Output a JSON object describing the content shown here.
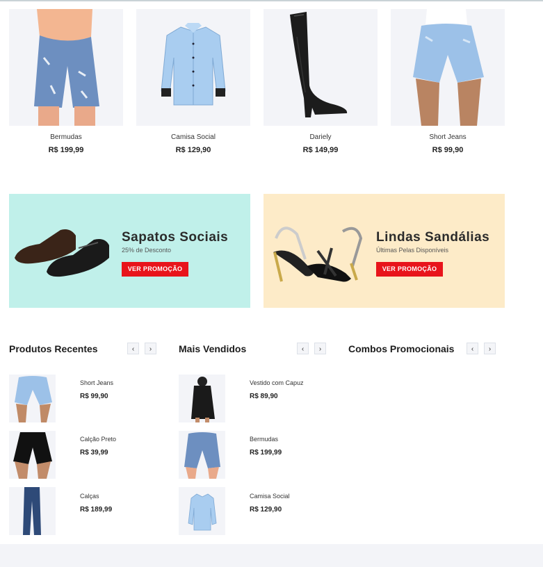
{
  "products": [
    {
      "name": "Bermudas",
      "price": "R$ 199,99",
      "icon": "bermuda-photo"
    },
    {
      "name": "Camisa Social",
      "price": "R$ 129,90",
      "icon": "shirt-photo"
    },
    {
      "name": "Darіely",
      "price": "R$ 149,99",
      "icon": "boot-photo"
    },
    {
      "name": "Short Jeans",
      "price": "R$ 99,90",
      "icon": "shorts-photo"
    }
  ],
  "banners": [
    {
      "title": "Sapatos Sociais",
      "subtitle": "25% de Desconto",
      "button": "VER PROMOÇÃO",
      "bg": "#c0f0ea"
    },
    {
      "title": "Lindas Sandálias",
      "subtitle": "Últimas Pelas Disponíveis",
      "button": "VER PROMOÇÃO",
      "bg": "#fdebc8"
    }
  ],
  "sections": {
    "recent": {
      "title": "Produtos Recentes",
      "items": [
        {
          "name": "Short Jeans",
          "price": "R$ 99,90"
        },
        {
          "name": "Calção Preto",
          "price": "R$ 39,99"
        },
        {
          "name": "Calças",
          "price": "R$ 189,99"
        }
      ]
    },
    "best": {
      "title": "Mais Vendidos",
      "items": [
        {
          "name": "Vestido com Capuz",
          "price": "R$ 89,90"
        },
        {
          "name": "Bermudas",
          "price": "R$ 199,99"
        },
        {
          "name": "Camisa Social",
          "price": "R$ 129,90"
        }
      ]
    },
    "combos": {
      "title": "Combos Promocionais",
      "items": []
    }
  },
  "arrows": {
    "prev": "‹",
    "next": "›"
  },
  "colors": {
    "accent_red": "#e8141b",
    "card_bg": "#f3f4f8"
  }
}
